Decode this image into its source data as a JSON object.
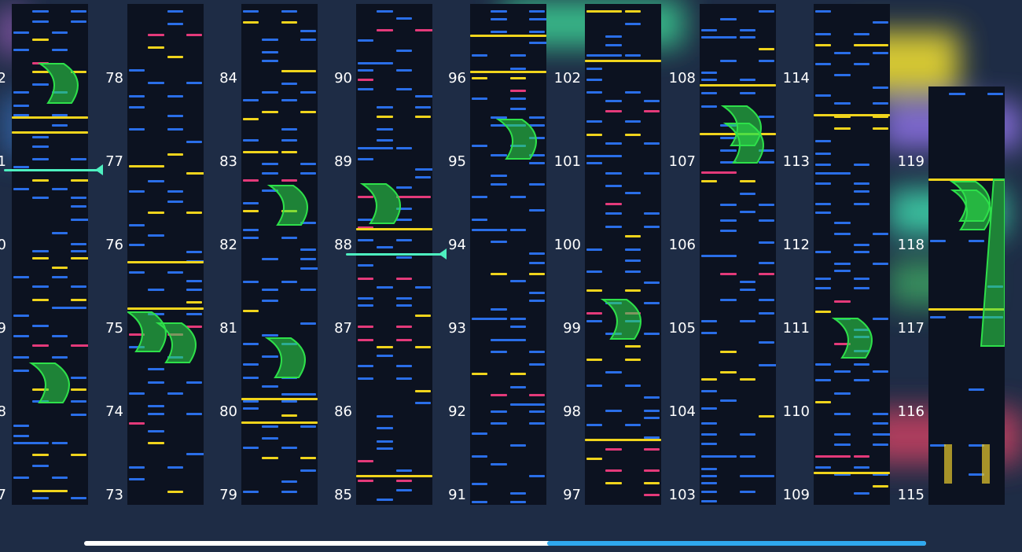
{
  "colors": {
    "tap": "#2a6ee8",
    "gold": "#f0d41c",
    "flick": "#e43a7a",
    "slide": "#2ee04a",
    "hold": "#eacb2e",
    "cursor": "#4ef0c0",
    "progress_played": "#ffffff",
    "progress_remaining": "#2fa8ef",
    "column_bg": "#0c1220"
  },
  "chart_view": {
    "columns": [
      {
        "measures": [
          "2",
          "1",
          "0",
          "9",
          "8",
          "7"
        ]
      },
      {
        "measures": [
          "78",
          "77",
          "76",
          "75",
          "74",
          "73"
        ]
      },
      {
        "measures": [
          "84",
          "83",
          "82",
          "81",
          "80",
          "79"
        ]
      },
      {
        "measures": [
          "90",
          "89",
          "88",
          "87",
          "86",
          "85"
        ]
      },
      {
        "measures": [
          "96",
          "95",
          "94",
          "93",
          "92",
          "91"
        ]
      },
      {
        "measures": [
          "102",
          "101",
          "100",
          "99",
          "98",
          "97"
        ]
      },
      {
        "measures": [
          "108",
          "107",
          "106",
          "105",
          "104",
          "103"
        ]
      },
      {
        "measures": [
          "114",
          "113",
          "112",
          "111",
          "110",
          "109"
        ]
      },
      {
        "measures": [
          "119",
          "118",
          "117",
          "116",
          "115"
        ]
      }
    ]
  },
  "progress": {
    "played_fraction": 0.55
  }
}
